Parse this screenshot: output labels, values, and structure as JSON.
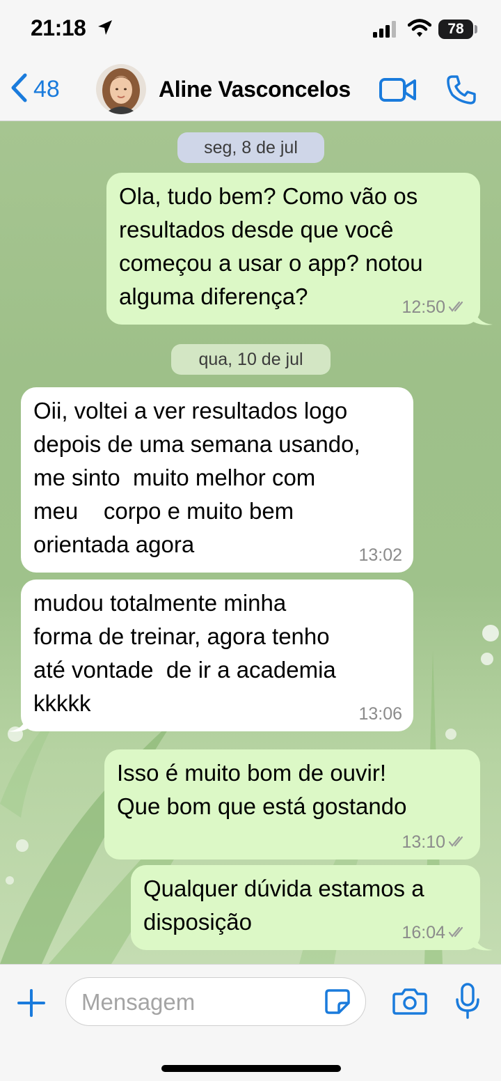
{
  "status_bar": {
    "time": "21:18",
    "battery": "78"
  },
  "header": {
    "back_count": "48",
    "contact_name": "Aline Vasconcelos"
  },
  "chat": {
    "date_1": "seg, 8 de jul",
    "msg_1": {
      "lines": [
        "Ola, tudo bem? Como vão os",
        "resultados desde que você",
        "começou a usar o app? notou",
        "alguma diferença?"
      ],
      "time": "12:50"
    },
    "date_2": "qua, 10 de jul",
    "msg_2": {
      "lines": [
        "Oii, voltei a ver resultados logo",
        "depois de uma semana usando,",
        "me sinto  muito melhor com",
        "meu    corpo e muito bem",
        "orientada agora"
      ],
      "time": "13:02"
    },
    "msg_3": {
      "lines": [
        "mudou totalmente minha",
        "forma de treinar, agora tenho",
        "até vontade  de ir a academia",
        "kkkkk"
      ],
      "time": "13:06"
    },
    "msg_4": {
      "lines": [
        "Isso é muito bom de ouvir!",
        "Que bom que está gostando"
      ],
      "time": "13:10"
    },
    "msg_5": {
      "lines": [
        "Qualquer dúvida estamos a",
        "disposição"
      ],
      "time": "16:04"
    }
  },
  "composer": {
    "placeholder": "Mensagem"
  },
  "colors": {
    "accent": "#1a7bdc",
    "outgoing_bubble": "#dcf8c6",
    "incoming_bubble": "#ffffff"
  }
}
